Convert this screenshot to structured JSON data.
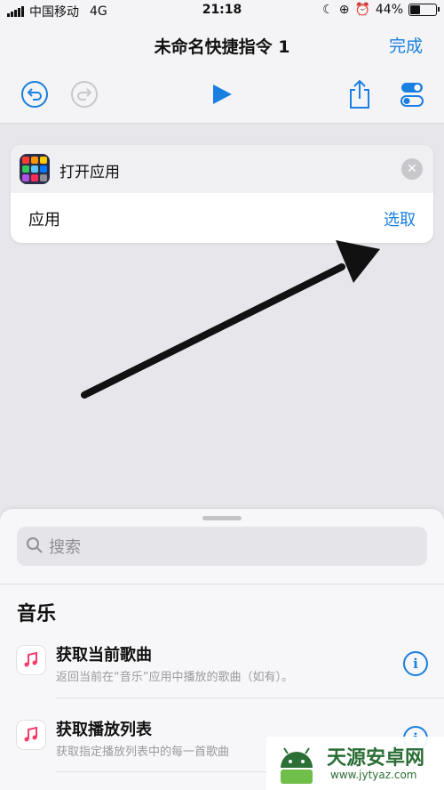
{
  "status_bar": {
    "carrier": "中国移动",
    "network": "4G",
    "time": "21:18",
    "battery": "44%",
    "battery_level": 0.44
  },
  "nav": {
    "title": "未命名快捷指令 1",
    "done_label": "完成"
  },
  "action_card": {
    "title": "打开应用",
    "param_label": "应用",
    "param_value": "选取",
    "icon_colors": [
      "#ff3b30",
      "#ff9500",
      "#ffcc00",
      "#34c759",
      "#5ac8fa",
      "#007aff",
      "#af52de",
      "#ff2d55",
      "#8e8e93"
    ]
  },
  "sheet": {
    "search_placeholder": "搜索",
    "section_title": "音乐",
    "items": [
      {
        "title": "获取当前歌曲",
        "description": "返回当前在“音乐”应用中播放的歌曲（如有）。"
      },
      {
        "title": "获取播放列表",
        "description": "获取指定播放列表中的每一首歌曲"
      }
    ]
  },
  "watermark": {
    "name": "天源安卓网",
    "url": "www.jytyaz.com"
  },
  "colors": {
    "accent": "#1a7fe0",
    "background": "#e6e6eb",
    "music_pink": "#fa3c6c"
  }
}
